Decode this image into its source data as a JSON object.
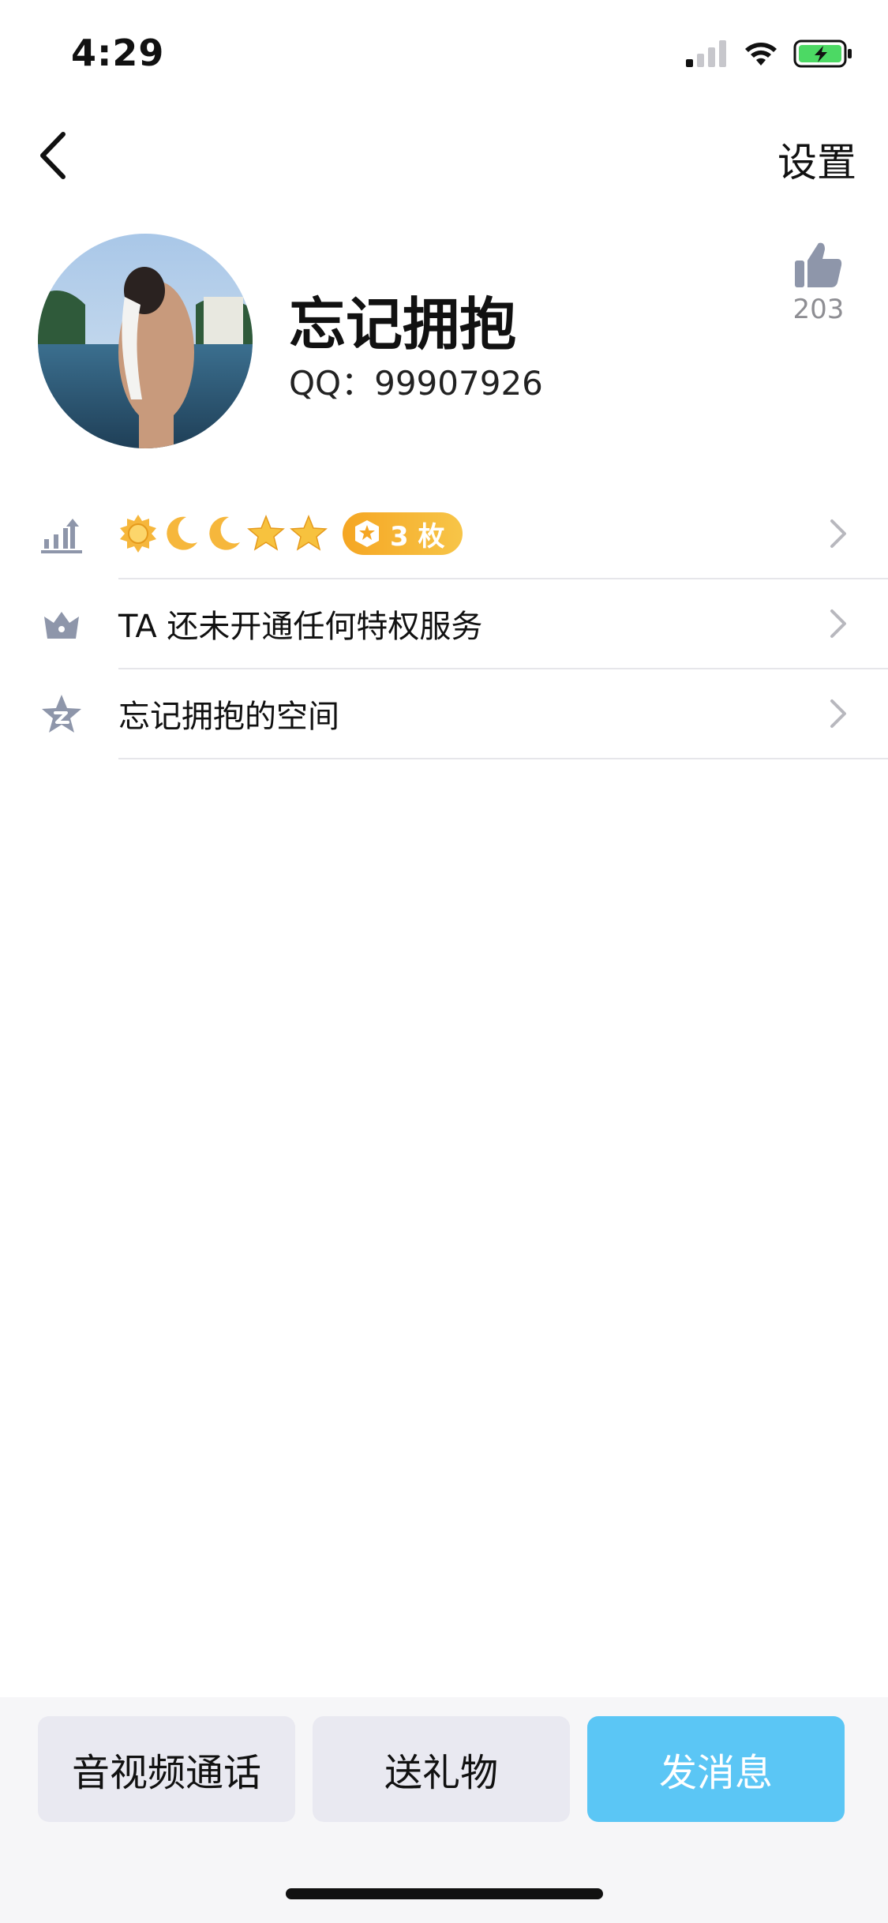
{
  "status_bar": {
    "time": "4:29",
    "signal_icon": "cellular-signal-icon",
    "wifi_icon": "wifi-icon",
    "battery_icon": "battery-charging-icon",
    "battery_color": "#4cd964"
  },
  "nav": {
    "back_icon": "chevron-left-icon",
    "settings_label": "设置"
  },
  "profile": {
    "name": "忘记拥抱",
    "qq": "QQ：99907926",
    "like_count": "203",
    "like_icon": "thumbs-up-icon"
  },
  "list": {
    "level_row": {
      "icon": "level-up-icon",
      "level_icons": [
        "sun-icon",
        "moon-icon",
        "moon-icon",
        "star-icon",
        "star-icon"
      ],
      "badge_text": "3 枚",
      "badge_color": "#f5a623"
    },
    "privilege_row": {
      "icon": "crown-icon",
      "label": "TA 还未开通任何特权服务"
    },
    "space_row": {
      "icon": "qzone-star-icon",
      "label": "忘记拥抱的空间"
    }
  },
  "bottom_bar": {
    "video_call_label": "音视频通话",
    "gift_label": "送礼物",
    "message_label": "发消息",
    "accent_color": "#5bc6f5"
  }
}
